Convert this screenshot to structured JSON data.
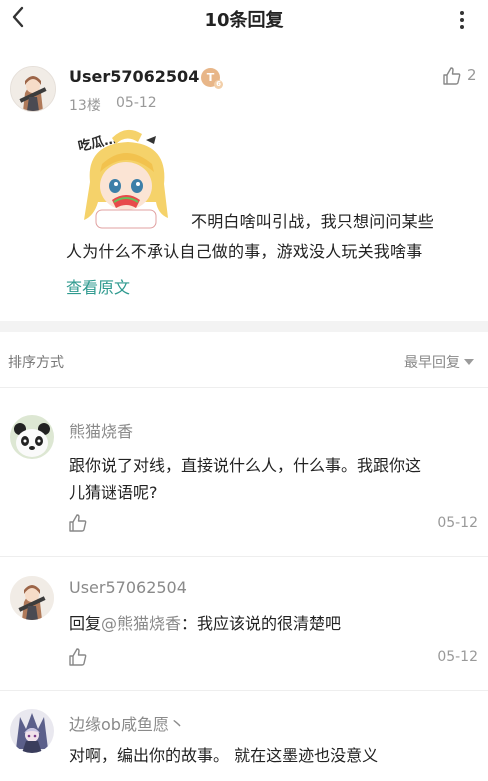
{
  "header": {
    "title": "10条回复"
  },
  "post": {
    "username": "User57062504",
    "level_badge": "T",
    "level_sub": "6",
    "floor": "13楼",
    "date": "05-12",
    "like_count": "2",
    "sticker_text": "吃瓜…",
    "content_lines": [
      "不明白啥叫引战，我只想问问某些",
      "人为什么不承认自己做的事，游戏没人玩关我啥事"
    ],
    "view_original": "查看原文"
  },
  "sort": {
    "label": "排序方式",
    "selected": "最早回复"
  },
  "replies": [
    {
      "username": "熊猫烧香",
      "lines": [
        "跟你说了对线，直接说什么人，什么事。我跟你这",
        "儿猜谜语呢?"
      ],
      "date": "05-12"
    },
    {
      "username": "User57062504",
      "reply_prefix": "回复",
      "mention": "@熊猫烧香",
      "text": "：我应该说的很清楚吧",
      "date": "05-12"
    },
    {
      "username": "边缘ob咸鱼愿丶",
      "lines": [
        "对啊，编出你的故事。  就在这墨迹也没意义"
      ]
    }
  ],
  "colors": {
    "accent": "#2f9a8f",
    "muted": "#999999",
    "badge": "#e8b688"
  }
}
